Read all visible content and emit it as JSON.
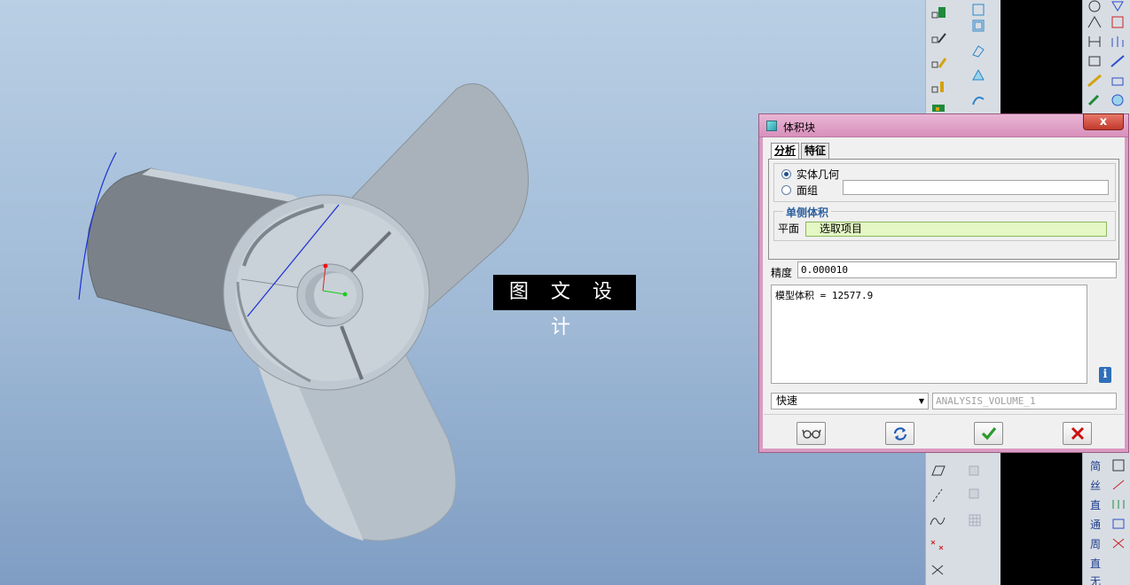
{
  "watermark": {
    "text": "图 文 设 计"
  },
  "dialog": {
    "title": "体积块",
    "close_label": "x",
    "tabs": [
      {
        "label": "分析",
        "active": true
      },
      {
        "label": "特征",
        "active": false
      }
    ],
    "options": {
      "solid_label": "实体几何",
      "solid_selected": true,
      "quilt_label": "面组",
      "quilt_value": ""
    },
    "one_side_volume": {
      "title": "单侧体积",
      "plane_label": "平面",
      "plane_value": "选取项目"
    },
    "precision": {
      "label": "精度",
      "value": "0.000010"
    },
    "result_text": "模型体积 = 12577.9",
    "info_icon": "i",
    "mode": {
      "selected": "快速",
      "analysis_name_placeholder": "ANALYSIS_VOLUME_1"
    },
    "buttons": {
      "preview": "glasses-icon",
      "repeat": "refresh-icon",
      "ok": "checkmark-icon",
      "cancel": "x-icon"
    }
  },
  "right_toolbar_labels": [
    "简",
    "丝",
    "直",
    "通",
    "周",
    "直",
    "无"
  ],
  "colors": {
    "viewport_top": "#b9cfe4",
    "viewport_bottom": "#7f9dc3",
    "model_fill": "#c4cdd6",
    "model_shadow": "#7a8088",
    "dialog_title": "#d890bc",
    "ok_green": "#2a9a2a",
    "cancel_red": "#cc1111"
  }
}
